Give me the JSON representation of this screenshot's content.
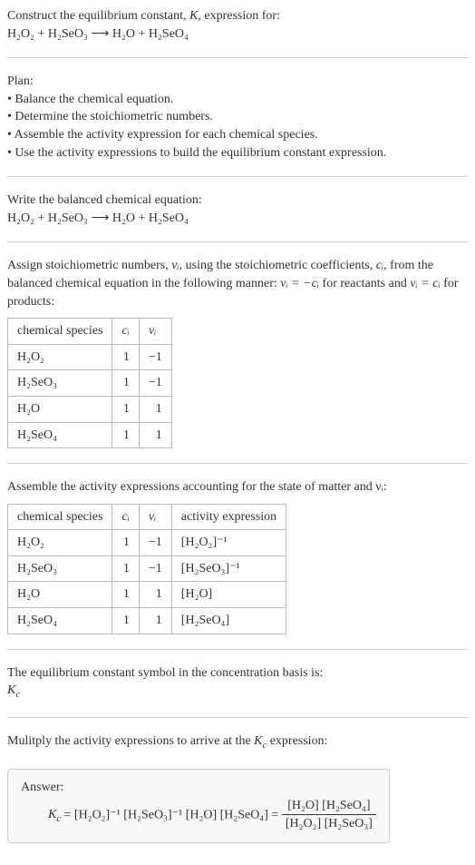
{
  "intro": {
    "line1": "Construct the equilibrium constant, ",
    "kvar": "K",
    "line1b": ", expression for:",
    "equation": "H₂O₂ + H₂SeO₃  ⟶  H₂O + H₂SeO₄"
  },
  "plan": {
    "heading": "Plan:",
    "items": [
      "• Balance the chemical equation.",
      "• Determine the stoichiometric numbers.",
      "• Assemble the activity expression for each chemical species.",
      "• Use the activity expressions to build the equilibrium constant expression."
    ]
  },
  "balanced": {
    "heading": "Write the balanced chemical equation:",
    "equation": "H₂O₂ + H₂SeO₃  ⟶  H₂O + H₂SeO₄"
  },
  "stoich": {
    "text1": "Assign stoichiometric numbers, ",
    "nu_i": "νᵢ",
    "text2": ", using the stoichiometric coefficients, ",
    "c_i": "cᵢ",
    "text3": ", from the balanced chemical equation in the following manner: ",
    "relation1": "νᵢ = −cᵢ",
    "text4": " for reactants and ",
    "relation2": "νᵢ = cᵢ",
    "text5": " for products:",
    "headers": [
      "chemical species",
      "cᵢ",
      "νᵢ"
    ],
    "rows": [
      {
        "species": "H₂O₂",
        "c": "1",
        "nu": "−1"
      },
      {
        "species": "H₂SeO₃",
        "c": "1",
        "nu": "−1"
      },
      {
        "species": "H₂O",
        "c": "1",
        "nu": "1"
      },
      {
        "species": "H₂SeO₄",
        "c": "1",
        "nu": "1"
      }
    ]
  },
  "activity": {
    "heading": "Assemble the activity expressions accounting for the state of matter and νᵢ:",
    "headers": [
      "chemical species",
      "cᵢ",
      "νᵢ",
      "activity expression"
    ],
    "rows": [
      {
        "species": "H₂O₂",
        "c": "1",
        "nu": "−1",
        "expr": "[H₂O₂]⁻¹"
      },
      {
        "species": "H₂SeO₃",
        "c": "1",
        "nu": "−1",
        "expr": "[H₂SeO₃]⁻¹"
      },
      {
        "species": "H₂O",
        "c": "1",
        "nu": "1",
        "expr": "[H₂O]"
      },
      {
        "species": "H₂SeO₄",
        "c": "1",
        "nu": "1",
        "expr": "[H₂SeO₄]"
      }
    ]
  },
  "symbol": {
    "text": "The equilibrium constant symbol in the concentration basis is:",
    "kc": "K_c"
  },
  "mult": {
    "heading_a": "Mulitply the activity expressions to arrive at the ",
    "kc": "K_c",
    "heading_b": " expression:"
  },
  "answer": {
    "label": "Answer:",
    "kc": "K_c",
    "lhs": " = [H₂O₂]⁻¹ [H₂SeO₃]⁻¹ [H₂O] [H₂SeO₄] = ",
    "frac_num": "[H₂O] [H₂SeO₄]",
    "frac_den": "[H₂O₂] [H₂SeO₃]"
  },
  "chart_data": {
    "type": "table",
    "tables": [
      {
        "title": "Stoichiometric numbers",
        "columns": [
          "chemical species",
          "c_i",
          "nu_i"
        ],
        "rows": [
          [
            "H2O2",
            1,
            -1
          ],
          [
            "H2SeO3",
            1,
            -1
          ],
          [
            "H2O",
            1,
            1
          ],
          [
            "H2SeO4",
            1,
            1
          ]
        ]
      },
      {
        "title": "Activity expressions",
        "columns": [
          "chemical species",
          "c_i",
          "nu_i",
          "activity expression"
        ],
        "rows": [
          [
            "H2O2",
            1,
            -1,
            "[H2O2]^-1"
          ],
          [
            "H2SeO3",
            1,
            -1,
            "[H2SeO3]^-1"
          ],
          [
            "H2O",
            1,
            1,
            "[H2O]"
          ],
          [
            "H2SeO4",
            1,
            1,
            "[H2SeO4]"
          ]
        ]
      }
    ]
  }
}
